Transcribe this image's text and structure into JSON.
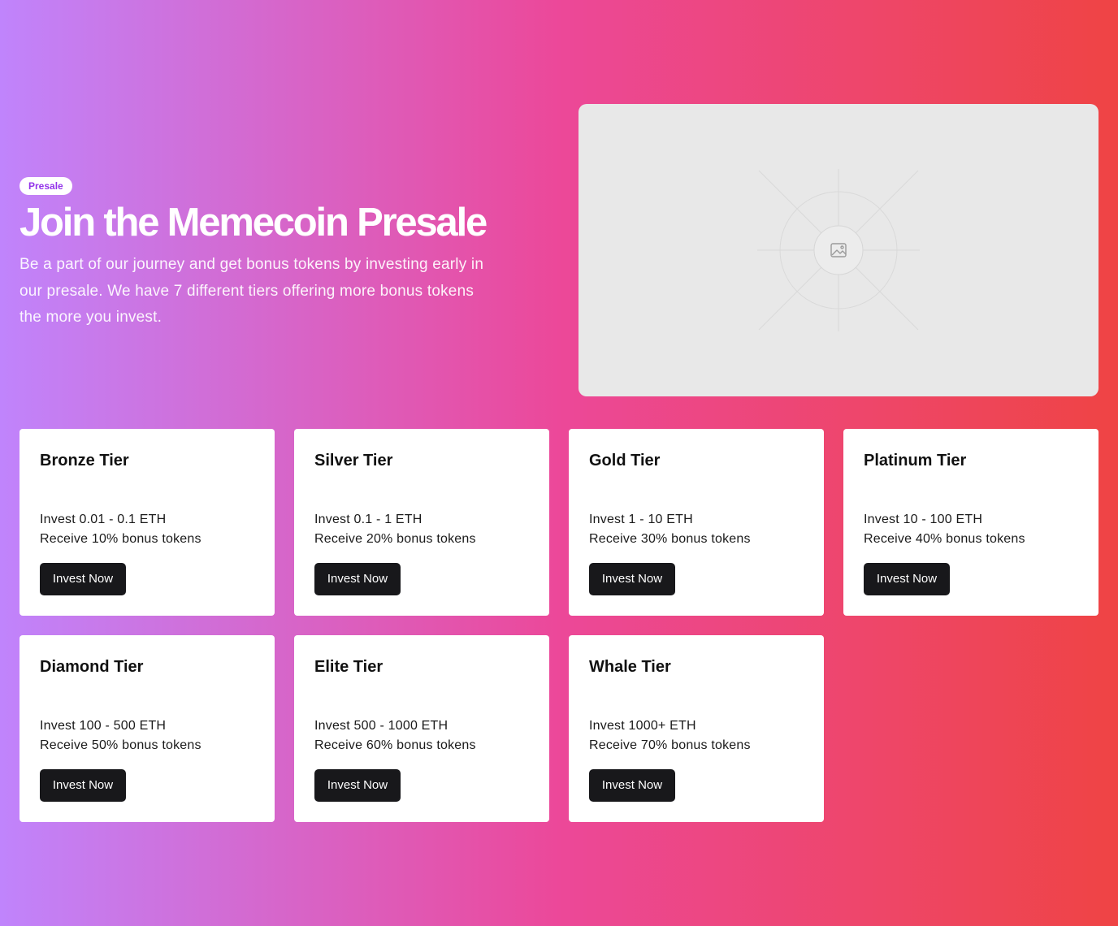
{
  "hero": {
    "badge": "Presale",
    "title": "Join the Memecoin Presale",
    "description": "Be a part of our journey and get bonus tokens by investing early in our presale. We have 7 different tiers offering more bonus tokens the more you invest.",
    "image_icon": "image-placeholder-icon"
  },
  "colors": {
    "gradient_start": "#c084fc",
    "gradient_mid": "#ec4899",
    "gradient_end": "#ef4444",
    "button_bg": "#18181b",
    "badge_text": "#9333ea"
  },
  "tiers": [
    {
      "name": "Bronze Tier",
      "invest": "Invest 0.01 - 0.1 ETH",
      "bonus": "Receive 10% bonus tokens",
      "button": "Invest Now"
    },
    {
      "name": "Silver Tier",
      "invest": "Invest 0.1 - 1 ETH",
      "bonus": "Receive 20% bonus tokens",
      "button": "Invest Now"
    },
    {
      "name": "Gold Tier",
      "invest": "Invest 1 - 10 ETH",
      "bonus": "Receive 30% bonus tokens",
      "button": "Invest Now"
    },
    {
      "name": "Platinum Tier",
      "invest": "Invest 10 - 100 ETH",
      "bonus": "Receive 40% bonus tokens",
      "button": "Invest Now"
    },
    {
      "name": "Diamond Tier",
      "invest": "Invest 100 - 500 ETH",
      "bonus": "Receive 50% bonus tokens",
      "button": "Invest Now"
    },
    {
      "name": "Elite Tier",
      "invest": "Invest 500 - 1000 ETH",
      "bonus": "Receive 60% bonus tokens",
      "button": "Invest Now"
    },
    {
      "name": "Whale Tier",
      "invest": "Invest 1000+ ETH",
      "bonus": "Receive 70% bonus tokens",
      "button": "Invest Now"
    }
  ]
}
